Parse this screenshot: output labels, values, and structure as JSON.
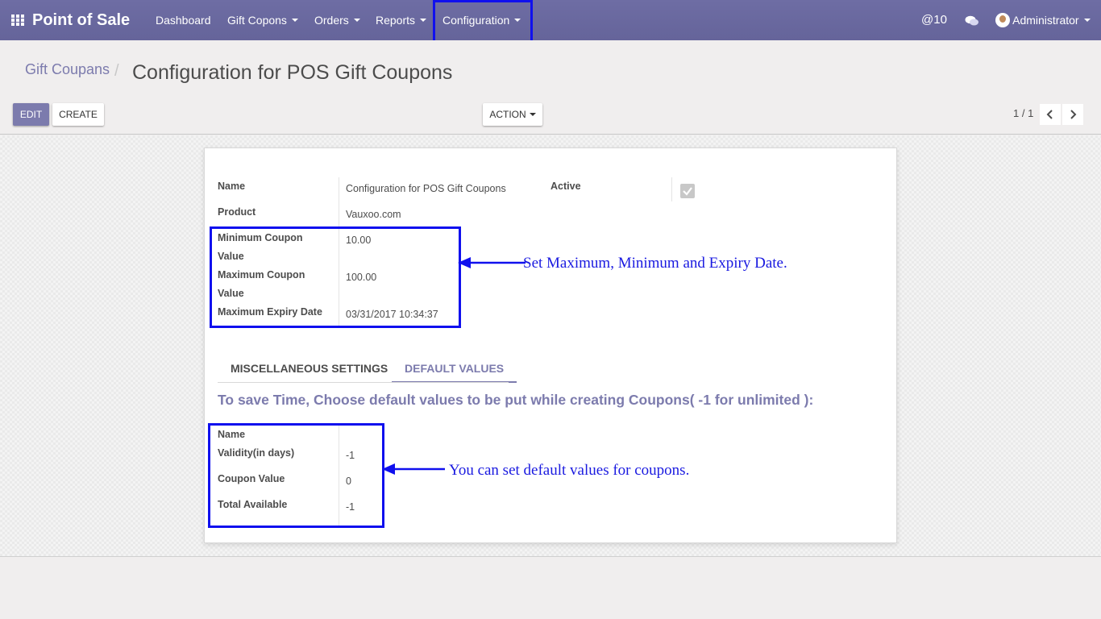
{
  "app": {
    "name": "Point of Sale",
    "menu": [
      {
        "label": "Dashboard"
      },
      {
        "label": "Gift Copons"
      },
      {
        "label": "Orders"
      },
      {
        "label": "Reports"
      },
      {
        "label": "Configuration"
      }
    ],
    "mentions_count": "10",
    "user": "Administrator"
  },
  "breadcrumb": {
    "parent": "Gift Coupans",
    "current": "Configuration for POS Gift Coupons"
  },
  "buttons": {
    "edit": "EDIT",
    "create": "CREATE",
    "action": "ACTION"
  },
  "pager": {
    "value": "1 / 1"
  },
  "form": {
    "name_label": "Name",
    "name_value": "Configuration for POS Gift Coupons",
    "active_label": "Active",
    "active_checked": true,
    "product_label": "Product",
    "product_value": "Vauxoo.com",
    "min_value_label_1": "Minimum Coupon",
    "min_value_label_2": "Value",
    "min_value": "10.00",
    "max_value_label_1": "Maximum Coupon",
    "max_value_label_2": "Value",
    "max_value": "100.00",
    "expiry_label": "Maximum Expiry Date",
    "expiry_value": "03/31/2017 10:34:37"
  },
  "tabs": [
    {
      "label": "MISCELLANEOUS SETTINGS",
      "active": false
    },
    {
      "label": "DEFAULT VALUES",
      "active": true
    }
  ],
  "default_values": {
    "heading": "To save Time, Choose default values to be put while creating Coupons( -1 for unlimited ):",
    "name_label": "Name",
    "validity_label": "Validity(in days)",
    "validity_value": "-1",
    "coupon_value_label": "Coupon Value",
    "coupon_value": "0",
    "total_label": "Total Available",
    "total_value": "-1"
  },
  "annotations": {
    "top": "Set Maximum, Minimum and Expiry Date.",
    "bottom": "You can set default values for coupons."
  },
  "colors": {
    "navbar": "#6c6b9f",
    "accent": "#7c7bad",
    "highlight": "#1010ee"
  }
}
